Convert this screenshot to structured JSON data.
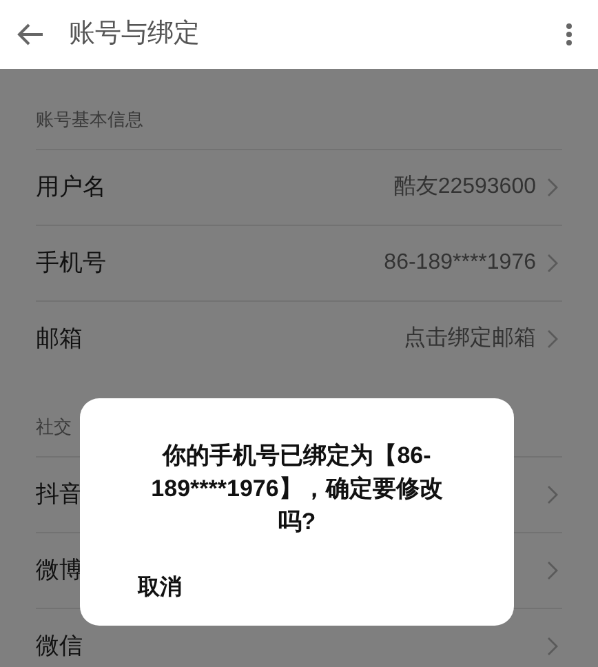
{
  "header": {
    "title": "账号与绑定"
  },
  "sections": [
    {
      "label": "账号基本信息",
      "rows": [
        {
          "name": "用户名",
          "value": "酷友22593600"
        },
        {
          "name": "手机号",
          "value": "86-189****1976"
        },
        {
          "name": "邮箱",
          "value": "点击绑定邮箱"
        }
      ]
    },
    {
      "label": "社交",
      "rows": [
        {
          "name": "抖音"
        },
        {
          "name": "微博"
        },
        {
          "name": "微信"
        }
      ]
    }
  ],
  "dialog": {
    "message": "你的手机号已绑定为【86-189****1976】，确定要修改吗?",
    "buttons": [
      "取消"
    ]
  }
}
